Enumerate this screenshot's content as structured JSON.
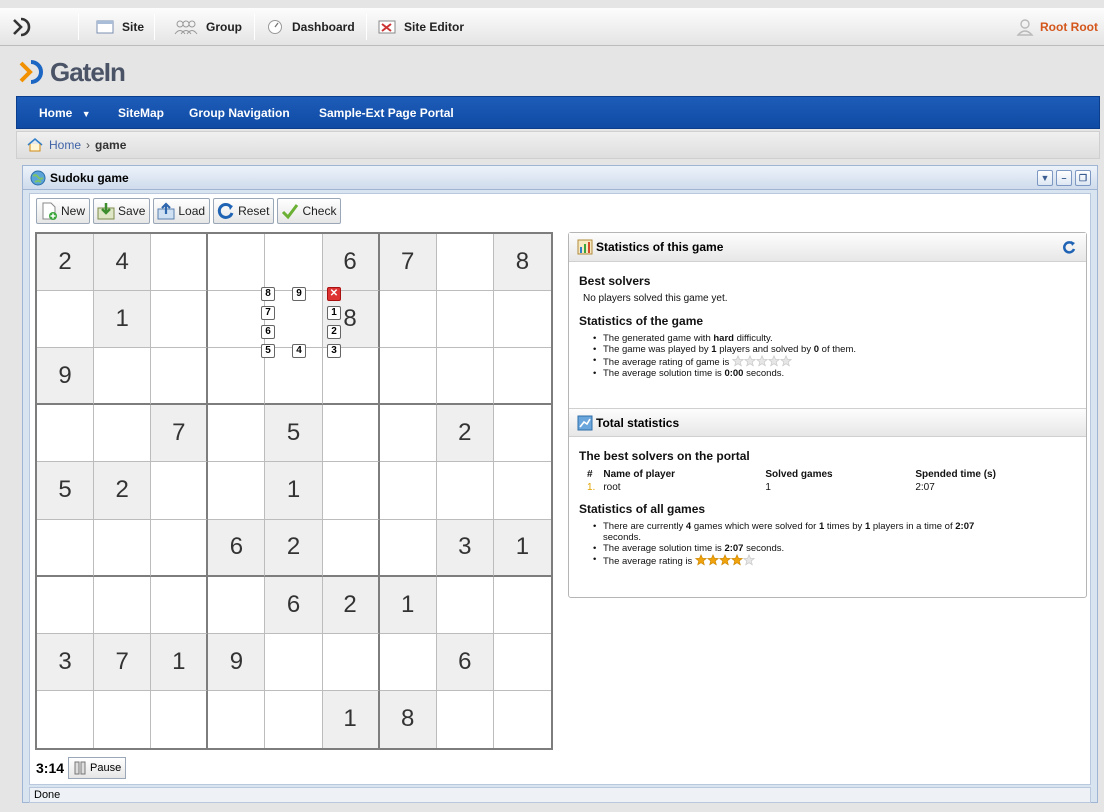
{
  "toolbar": {
    "site": "Site",
    "group": "Group",
    "dashboard": "Dashboard",
    "site_editor": "Site Editor",
    "user": "Root Root"
  },
  "brand": {
    "name": "GateIn"
  },
  "nav": {
    "home": "Home",
    "sitemap": "SiteMap",
    "group_navigation": "Group Navigation",
    "sample": "Sample-Ext Page Portal"
  },
  "breadcrumb": {
    "home": "Home",
    "separator": "›",
    "current": "game"
  },
  "portlet": {
    "title": "Sudoku game"
  },
  "game_toolbar": {
    "new": "New",
    "save": "Save",
    "load": "Load",
    "reset": "Reset",
    "check": "Check"
  },
  "sudoku": {
    "rows": [
      [
        "2",
        "4",
        "",
        "",
        "",
        "6",
        "7",
        "",
        "8"
      ],
      [
        "",
        "1",
        "",
        "",
        "",
        "8",
        "",
        "",
        ""
      ],
      [
        "9",
        "",
        "",
        "",
        "",
        "",
        "",
        "",
        ""
      ],
      [
        "",
        "",
        "7",
        "",
        "5",
        "",
        "",
        "2",
        ""
      ],
      [
        "5",
        "2",
        "",
        "",
        "1",
        "",
        "",
        "",
        ""
      ],
      [
        "",
        "",
        "",
        "6",
        "2",
        "",
        "",
        "3",
        "1"
      ],
      [
        "",
        "",
        "",
        "",
        "6",
        "2",
        "1",
        "",
        ""
      ],
      [
        "3",
        "7",
        "1",
        "9",
        "",
        "",
        "",
        "6",
        ""
      ],
      [
        "",
        "",
        "",
        "",
        "",
        "1",
        "8",
        "",
        ""
      ]
    ],
    "picker": [
      "8",
      "9",
      "7",
      "1",
      "6",
      "2",
      "5",
      "4",
      "3"
    ]
  },
  "timer": {
    "value": "3:14",
    "pause_label": "Pause"
  },
  "game_stats": {
    "title": "Statistics of this game",
    "best_solvers_heading": "Best solvers",
    "best_solvers_text": "No players solved this game yet.",
    "stats_heading": "Statistics of the game",
    "line1_a": "The generated game with ",
    "line1_b": "hard",
    "line1_c": " difficulty.",
    "line2_a": "The game was played by ",
    "line2_b": "1",
    "line2_c": " players and solved by ",
    "line2_d": "0",
    "line2_e": " of them.",
    "line3": "The average rating of game is",
    "rating": 0,
    "line4_a": "The average solution time is ",
    "line4_b": "0:00",
    "line4_c": " seconds."
  },
  "total_stats": {
    "title": "Total statistics",
    "best_heading": "The best solvers on the portal",
    "columns": [
      "#",
      "Name of player",
      "Solved games",
      "Spended time (s)"
    ],
    "rows": [
      {
        "rank": "1.",
        "name": "root",
        "solved": "1",
        "time": "2:07"
      }
    ],
    "all_heading": "Statistics of all games",
    "l1_a": "There are currently ",
    "l1_b": "4",
    "l1_c": " games which were solved for ",
    "l1_d": "1",
    "l1_e": " times by ",
    "l1_f": "1",
    "l1_g": " players in a time of ",
    "l1_h": "2:07",
    "l1_i": "seconds.",
    "l2_a": "The average solution time is ",
    "l2_b": "2:07",
    "l2_c": " seconds.",
    "l3": "The average rating is",
    "rating": 4
  },
  "status": {
    "text": "Done"
  },
  "colors": {
    "nav_bg": "#1456b0",
    "user_link": "#d4561b",
    "star": "#f0a30a"
  }
}
